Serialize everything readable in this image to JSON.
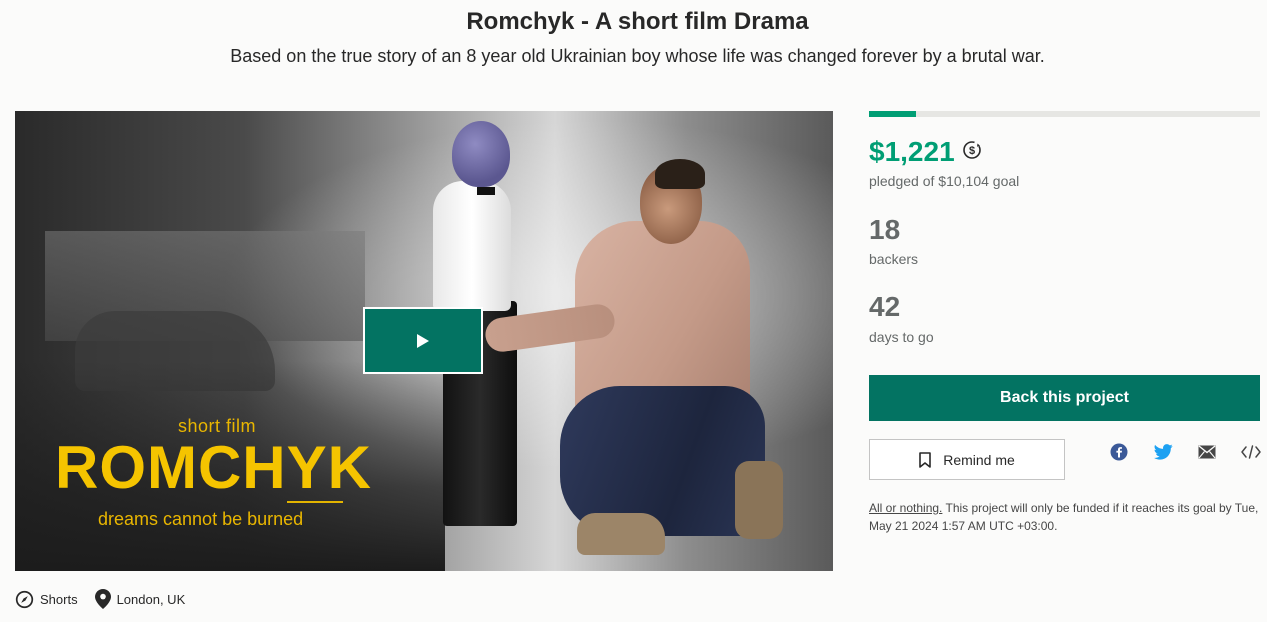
{
  "project": {
    "title": "Romchyk - A short film Drama",
    "blurb": "Based on the true story of an 8 year old Ukrainian boy whose life was changed forever by a brutal war."
  },
  "video": {
    "poster_label": "short film",
    "poster_title": "ROMCHYK",
    "poster_tagline": "dreams cannot be burned",
    "play_icon": "play-icon"
  },
  "meta": {
    "category": "Shorts",
    "category_icon": "compass-icon",
    "location": "London, UK",
    "location_icon": "map-pin-icon"
  },
  "stats": {
    "progress_fraction": 0.12,
    "pledged_amount": "$1,221",
    "pledged_caption": "pledged of $10,104 goal",
    "backers_count": "18",
    "backers_caption": "backers",
    "days_count": "42",
    "days_caption": "days to go"
  },
  "actions": {
    "back_label": "Back this project",
    "remind_label": "Remind me",
    "share_icons": [
      "facebook-icon",
      "twitter-icon",
      "email-icon",
      "embed-icon"
    ]
  },
  "funding_note": {
    "link_text": "All or nothing.",
    "text": " This project will only be funded if it reaches its goal by Tue, May 21 2024 1:57 AM UTC +03:00."
  },
  "colors": {
    "accent": "#009e74",
    "button": "#037362",
    "poster_yellow": "#f5c400"
  }
}
